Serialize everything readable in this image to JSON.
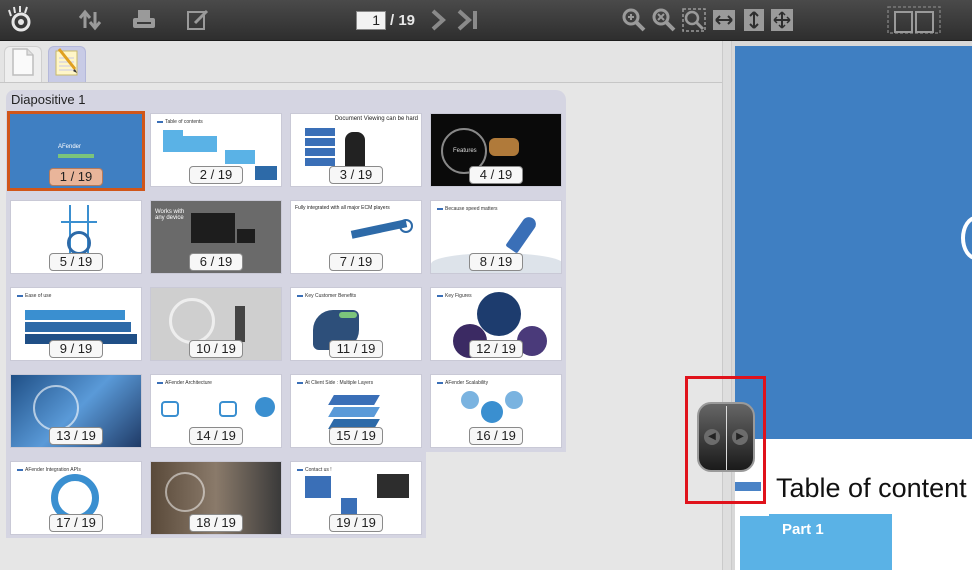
{
  "toolbar": {
    "current_page": "1",
    "total_pages": "/ 19",
    "icons": [
      "logo-eye-icon",
      "sort-icon",
      "print-icon",
      "annotate-icon",
      "next-page-icon",
      "last-page-icon",
      "zoom-in-icon",
      "zoom-out-icon",
      "zoom-fit-icon",
      "fit-width-icon",
      "fit-height-icon",
      "fullscreen-icon",
      "two-page-icon"
    ]
  },
  "tabs": [
    {
      "name": "pages-tab",
      "icon": "page-icon"
    },
    {
      "name": "annotations-tab",
      "icon": "notepad-icon"
    }
  ],
  "thumbnails_panel": {
    "group_title": "Diapositive 1",
    "thumbnails": [
      {
        "label": "1 / 19",
        "selected": true,
        "heading": "AFender"
      },
      {
        "label": "2 / 19",
        "heading": "Table of contents"
      },
      {
        "label": "3 / 19",
        "heading": "Document Viewing can be hard"
      },
      {
        "label": "4 / 19",
        "heading": "Features"
      },
      {
        "label": "5 / 19",
        "heading": ""
      },
      {
        "label": "6 / 19",
        "heading": "Works with any device"
      },
      {
        "label": "7 / 19",
        "heading": "Fully integrated with all major ECM players"
      },
      {
        "label": "8 / 19",
        "heading": "Because speed matters"
      },
      {
        "label": "9 / 19",
        "heading": "Ease of use"
      },
      {
        "label": "10 / 19",
        "heading": ""
      },
      {
        "label": "11 / 19",
        "heading": "Key Customer Benefits"
      },
      {
        "label": "12 / 19",
        "heading": "Key Figures"
      },
      {
        "label": "13 / 19",
        "heading": ""
      },
      {
        "label": "14 / 19",
        "heading": "AFender Architecture"
      },
      {
        "label": "15 / 19",
        "heading": "At Client Side : Multiple Layers"
      },
      {
        "label": "16 / 19",
        "heading": "AFender Scalability"
      },
      {
        "label": "17 / 19",
        "heading": "AFender Integration APIs"
      },
      {
        "label": "18 / 19",
        "heading": ""
      },
      {
        "label": "19 / 19",
        "heading": "Contact us !"
      }
    ]
  },
  "preview": {
    "slide_title": "Table of content",
    "part_label": "Part 1"
  },
  "colors": {
    "toolbar": "#3a3a3a",
    "selected_border": "#d0561a",
    "group_bg": "#d5d5e2",
    "slide_blue": "#3f7fc2",
    "splitter_highlight": "#e0121b"
  }
}
